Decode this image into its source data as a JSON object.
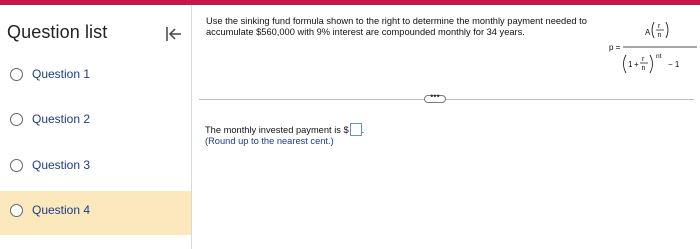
{
  "sidebar": {
    "title": "Question list",
    "collapse_icon": "collapse-left-icon",
    "items": [
      {
        "label": "Question 1",
        "active": false
      },
      {
        "label": "Question 2",
        "active": false
      },
      {
        "label": "Question 3",
        "active": false
      },
      {
        "label": "Question 4",
        "active": true
      }
    ]
  },
  "question": {
    "text": "Use the sinking fund formula shown to the right to determine the monthly payment needed to accumulate $560,000 with 9% interest are compounded monthly for 34 years.",
    "formula": {
      "lhs": "p =",
      "numerator_A": "A",
      "r": "r",
      "n": "n",
      "one": "1",
      "plus": "+",
      "exponent": "nt",
      "minus_one": "− 1"
    },
    "more_label": "•••"
  },
  "answer": {
    "prefix": "The monthly invested payment is $",
    "suffix": ".",
    "value": "",
    "hint": "(Round up to the nearest cent.)"
  },
  "colors": {
    "accent": "#c8164b",
    "active_item": "#fbe9bd",
    "link_text": "#1d3c87"
  }
}
